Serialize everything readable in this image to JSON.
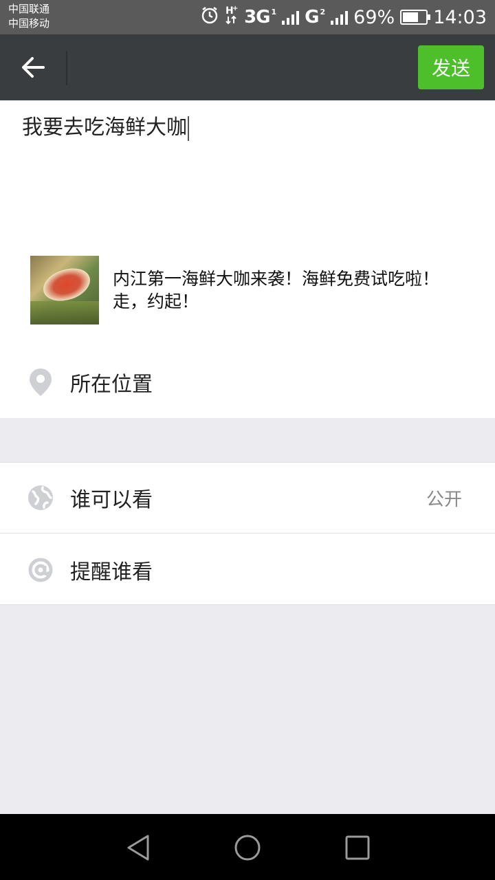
{
  "status_bar": {
    "carrier_1": "中国联通",
    "carrier_2": "中国移动",
    "network_1": "3G",
    "network_2": "G",
    "sim_1": "1",
    "sim_2": "2",
    "battery_percent": "69%",
    "battery_level": 0.69,
    "time": "14:03"
  },
  "title_bar": {
    "send_label": "发送",
    "send_color": "#4cbf2a",
    "background": "#3a3d3f"
  },
  "composer": {
    "text": "我要去吃海鲜大咖"
  },
  "link_card": {
    "title": "内江第一海鲜大咖来袭！海鲜免费试吃啦！走，约起！"
  },
  "location": {
    "label": "所在位置",
    "icon": "location-pin-icon"
  },
  "visibility": {
    "label": "谁可以看",
    "value": "公开",
    "icon": "globe-icon"
  },
  "mention": {
    "label": "提醒谁看",
    "icon": "at-icon"
  },
  "nav": {
    "back_icon": "nav-back-icon",
    "home_icon": "nav-home-icon",
    "recent_icon": "nav-recent-icon"
  }
}
